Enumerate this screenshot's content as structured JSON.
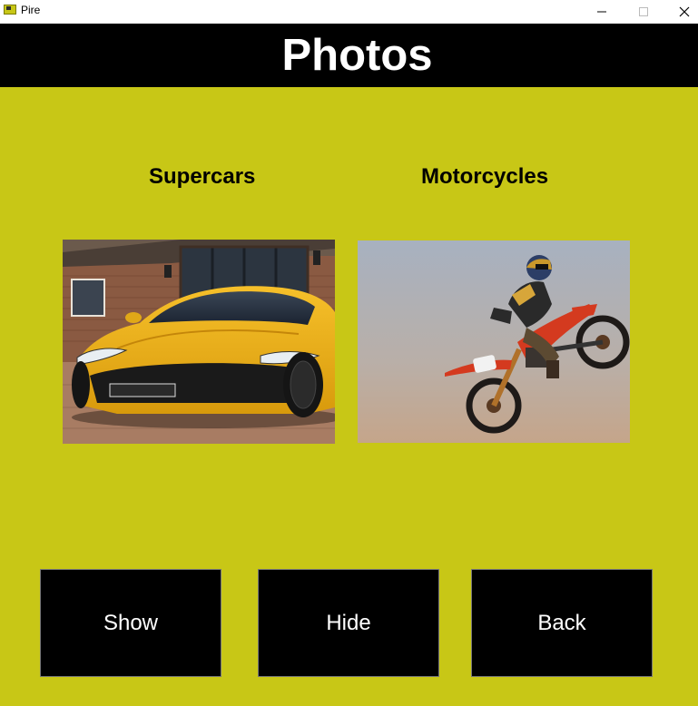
{
  "window": {
    "title": "Pire",
    "icon": "app-icon"
  },
  "header": {
    "title": "Photos"
  },
  "sections": [
    {
      "label": "Supercars",
      "photo": "yellow supercar in front of a brick house"
    },
    {
      "label": "Motorcycles",
      "photo": "motocross rider jumping a red dirt bike"
    }
  ],
  "buttons": {
    "show": "Show",
    "hide": "Hide",
    "back": "Back"
  },
  "colors": {
    "background": "#c8c716",
    "header": "#000000",
    "button": "#000000",
    "button_text": "#ffffff"
  }
}
